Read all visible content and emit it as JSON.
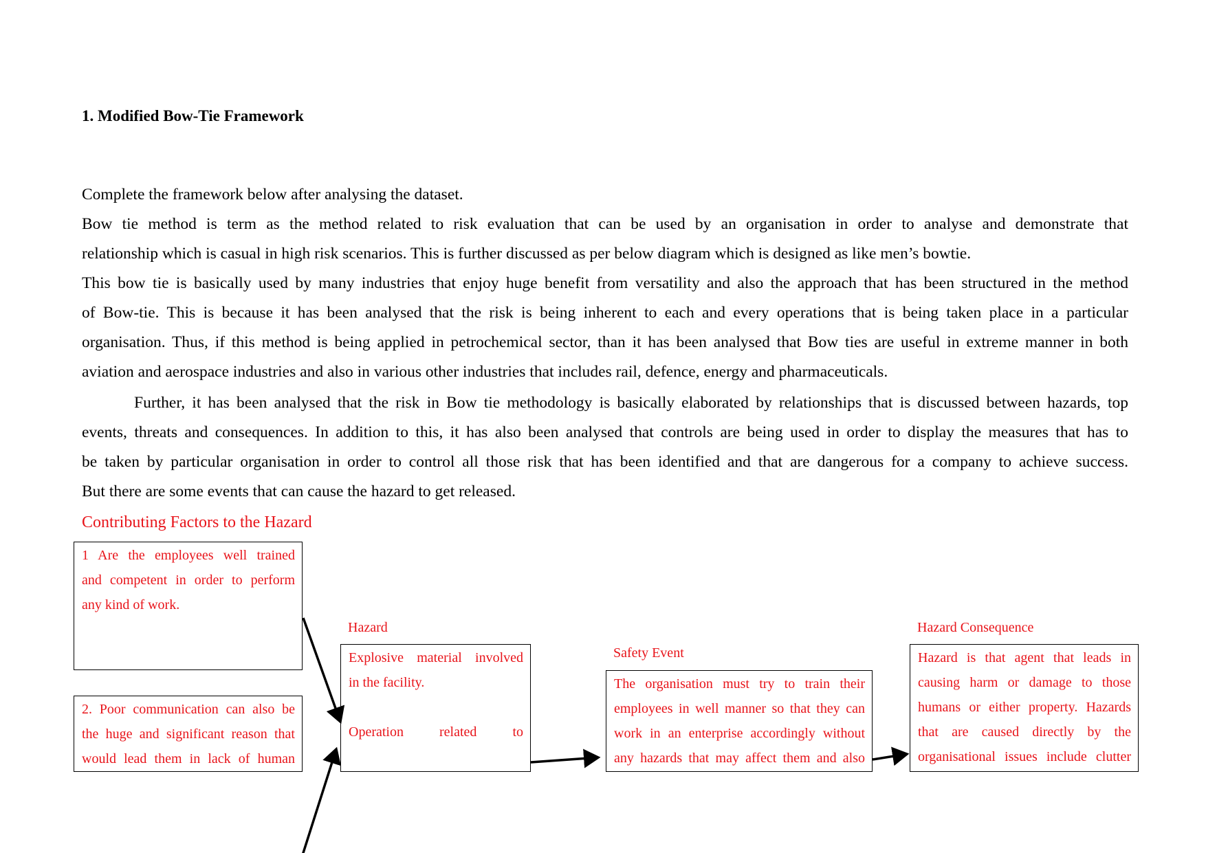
{
  "heading": "1. Modified Bow-Tie Framework",
  "intro": "Complete the framework below after analysing the dataset.",
  "paragraph1_lines": [
    "Bow tie method is term as the method related to risk evaluation that can be used by an organisation in order to analyse and demonstrate that",
    "relationship which is casual in high risk scenarios. This is further discussed as per below diagram which is designed as like men’s bowtie.",
    "This bow tie is basically used by many industries that enjoy huge benefit from versatility and also the approach that has been structured in the method",
    "of Bow-tie. This is because it has been analysed that the risk is being inherent to each and every operations that is being taken place in a particular",
    "organisation. Thus, if this method is being applied in petrochemical sector, than it has been analysed that Bow ties are useful in extreme manner in both",
    "aviation and aerospace industries and also in various other industries that includes rail, defence, energy and pharmaceuticals."
  ],
  "paragraph2_lines": [
    "Further, it has been analysed that the risk in Bow tie methodology is basically elaborated by relationships that is discussed between hazards, top",
    "events, threats and consequences. In addition to this, it has also been analysed that controls are being used in order to display the measures that has to",
    "be taken by particular organisation in order to control all those risk that has been identified and that are dangerous for a company to achieve success.",
    "But there are some events that can cause the hazard to get released."
  ],
  "diagram": {
    "contributing_title": "Contributing Factors to the Hazard",
    "factor1_lines": [
      "1 Are the employees well trained",
      "and competent in order to perform",
      "any kind of work."
    ],
    "factor2_lines": [
      "2. Poor communication can also be",
      "the huge and significant reason that",
      "would lead them in lack of human"
    ],
    "hazard_label": "Hazard",
    "hazard_lines": [
      "Explosive material involved",
      "in the facility.",
      "",
      "Operation related to"
    ],
    "safety_label": "Safety Event",
    "safety_lines": [
      "The organisation must try to train their",
      "employees in well manner so that they can",
      "work in an enterprise accordingly without",
      "any hazards that may affect them and also"
    ],
    "consequence_label": "Hazard Consequence",
    "consequence_lines": [
      "Hazard is that agent that leads in",
      "causing harm or damage to those",
      "humans or either property. Hazards",
      "that are caused directly by the",
      "organisational issues include clutter"
    ],
    "colors": {
      "diagram_text": "#e8141a",
      "body_text": "#000000"
    }
  }
}
